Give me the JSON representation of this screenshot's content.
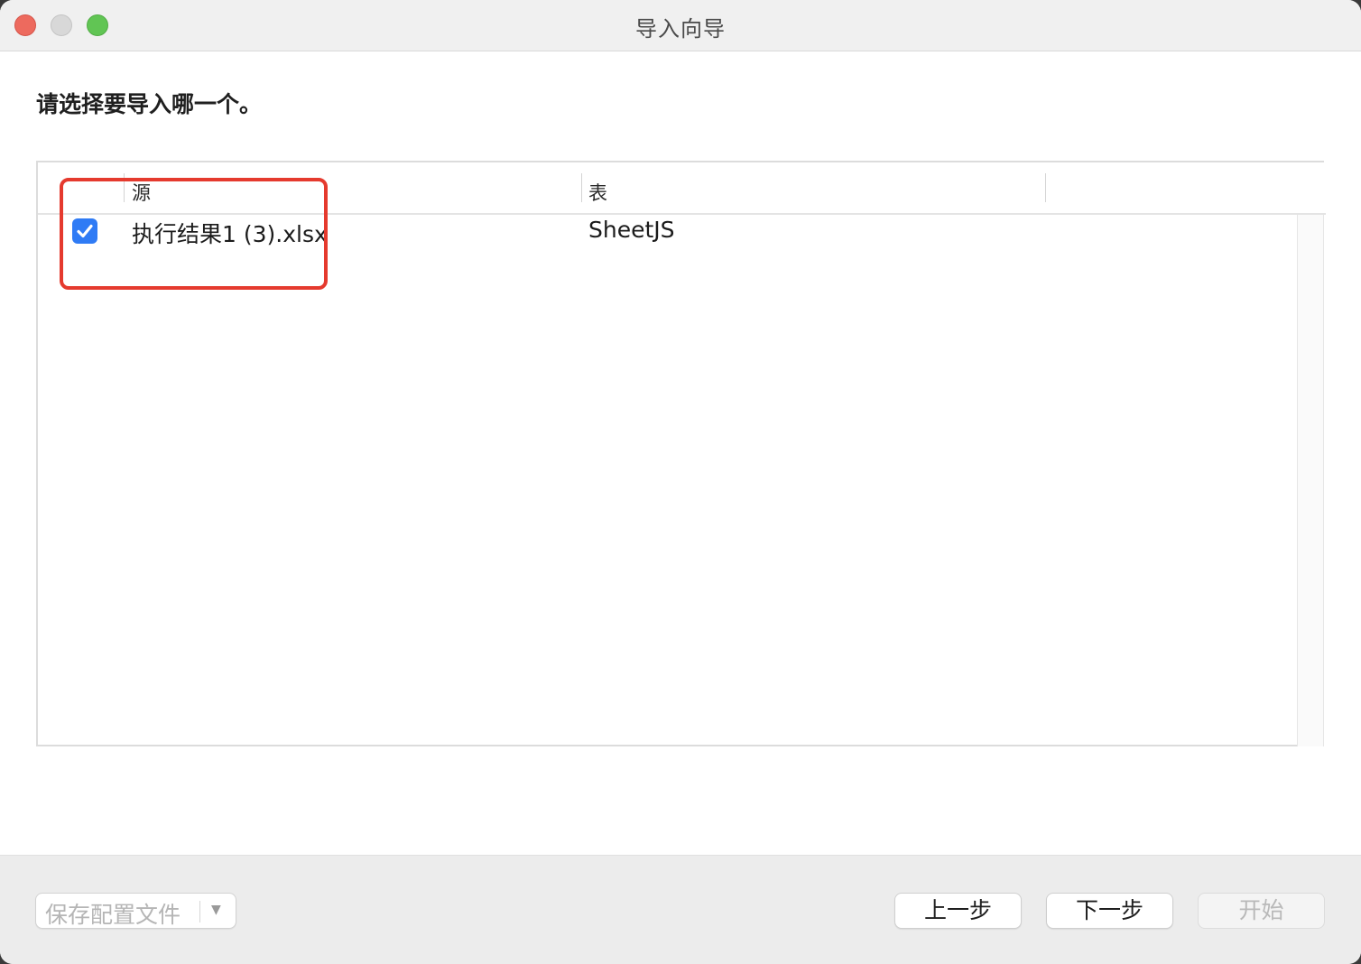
{
  "window": {
    "title": "导入向导"
  },
  "prompt": "请选择要导入哪一个。",
  "table": {
    "columns": [
      "源",
      "表"
    ],
    "rows": [
      {
        "checked": true,
        "source": "执行结果1 (3).xlsx",
        "table": "SheetJS"
      }
    ]
  },
  "footer": {
    "save_profile_label": "保存配置文件",
    "prev_label": "上一步",
    "next_label": "下一步",
    "start_label": "开始"
  },
  "colors": {
    "checkbox": "#2f7bf5",
    "highlight": "#e53a2e"
  },
  "icons": {
    "checkbox": "checkmark-icon",
    "dropdown": "chevron-down-icon"
  }
}
